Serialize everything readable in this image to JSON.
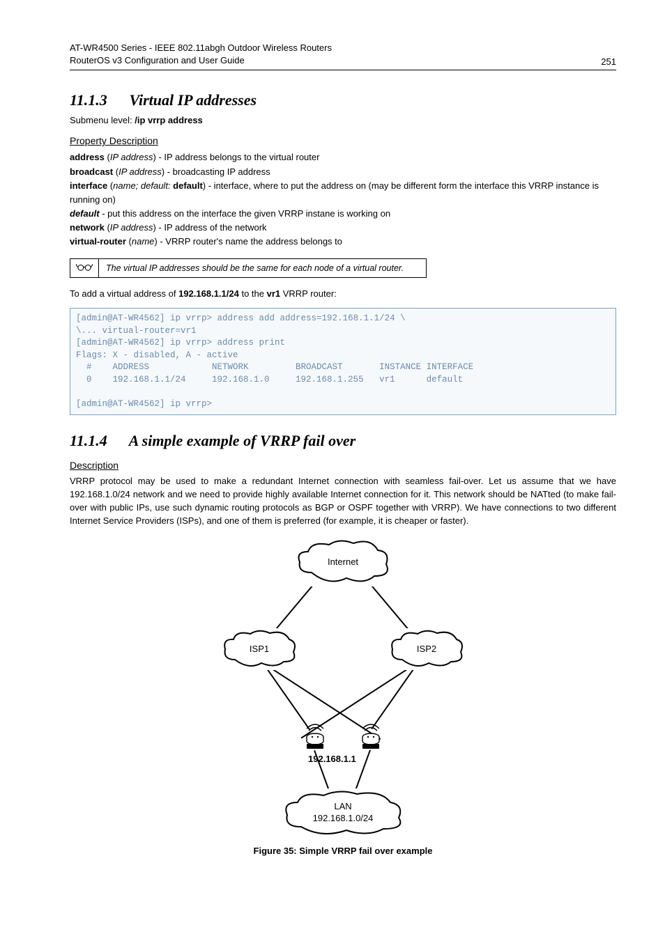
{
  "header": {
    "line1": "AT-WR4500 Series - IEEE 802.11abgh Outdoor Wireless Routers",
    "line2": "RouterOS v3 Configuration and User Guide",
    "page_number": "251"
  },
  "section_1113": {
    "number": "11.1.3",
    "title": "Virtual IP addresses",
    "submenu_prefix": "Submenu level: ",
    "submenu_cmd": "/ip vrrp address",
    "prop_heading": "Property Description",
    "props": [
      {
        "name": "address",
        "type": "IP address",
        "desc": " - IP address belongs to the virtual router"
      },
      {
        "name": "broadcast",
        "type": "IP address",
        "desc": " - broadcasting IP address"
      },
      {
        "name": "interface",
        "type_raw": "name; default: ",
        "type_bold": "default",
        "desc": " - interface, where to put the address on (may be different form the interface this VRRP instance is running on)"
      },
      {
        "name_italic": "default",
        "desc": " - put this address on the interface the given VRRP instane is working on"
      },
      {
        "name": "network",
        "type": "IP address",
        "desc": " - IP address of the network"
      },
      {
        "name": "virtual-router",
        "type": "name",
        "desc": " - VRRP router's name the address belongs to"
      }
    ],
    "note": "The virtual IP addresses should be the same for each node of a virtual router.",
    "example_intro_pre": "To add a virtual address of ",
    "example_addr": "192.168.1.1/24",
    "example_intro_mid": " to the ",
    "example_router": "vr1",
    "example_intro_post": " VRRP router:",
    "code": "[admin@AT-WR4562] ip vrrp> address add address=192.168.1.1/24 \\\n\\... virtual-router=vr1\n[admin@AT-WR4562] ip vrrp> address print\nFlags: X - disabled, A - active\n  #    ADDRESS            NETWORK         BROADCAST       INSTANCE INTERFACE\n  0    192.168.1.1/24     192.168.1.0     192.168.1.255   vr1      default\n\n[admin@AT-WR4562] ip vrrp>"
  },
  "section_1114": {
    "number": "11.1.4",
    "title": "A simple example of VRRP fail over",
    "desc_heading": "Description",
    "body": "VRRP protocol may be used to make a redundant Internet connection with seamless fail-over. Let us assume that we have 192.168.1.0/24 network and we need to provide highly available Internet connection for it. This network should be NATted (to make fail-over with public IPs, use such dynamic routing protocols as BGP or OSPF together with VRRP). We have connections to two different Internet Service Providers (ISPs), and one of them is preferred (for example, it is cheaper or faster)."
  },
  "diagram": {
    "internet": "Internet",
    "isp1": "ISP1",
    "isp2": "ISP2",
    "addr": "192.168.1.1",
    "lan_label": "LAN",
    "lan_net": "192.168.1.0/24"
  },
  "figure_caption": "Figure 35: Simple VRRP fail over example"
}
